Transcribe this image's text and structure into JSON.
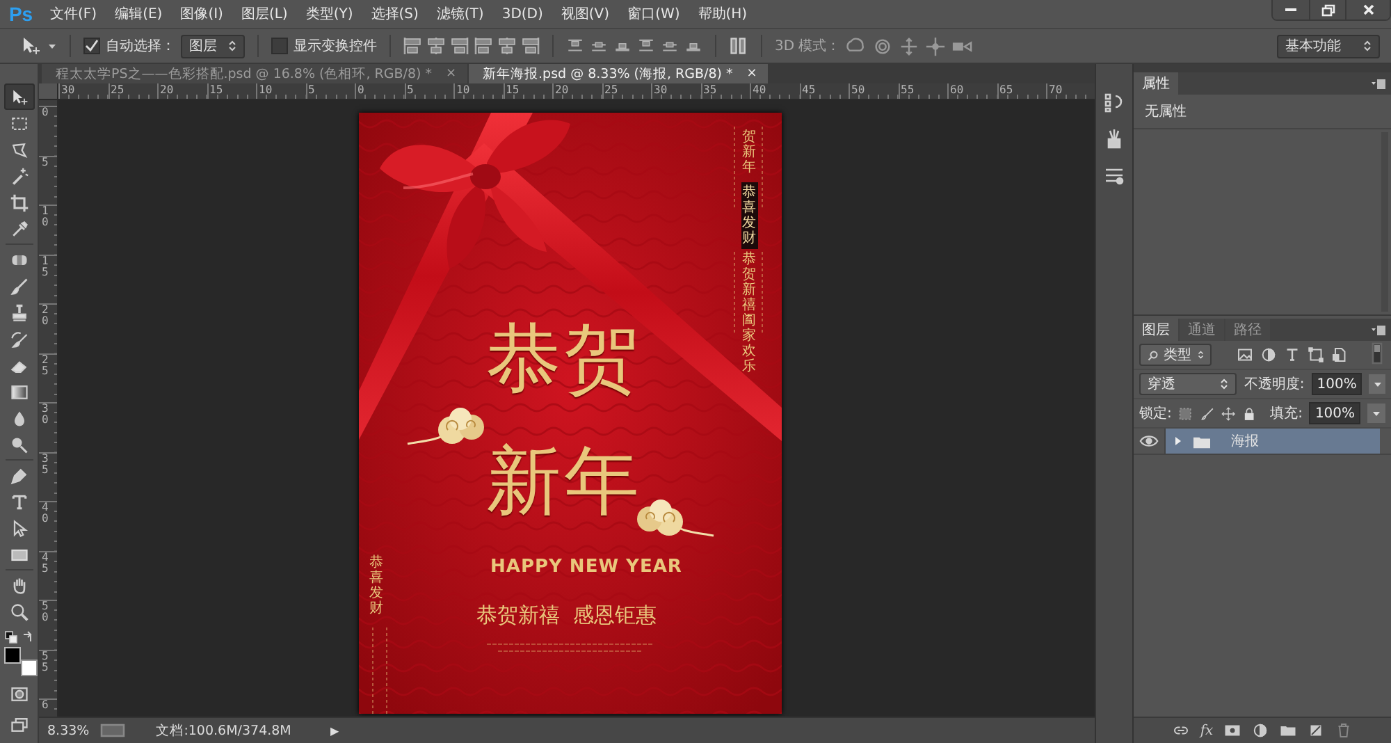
{
  "app_logo": "Ps",
  "menu": [
    "文件(F)",
    "编辑(E)",
    "图像(I)",
    "图层(L)",
    "类型(Y)",
    "选择(S)",
    "滤镜(T)",
    "3D(D)",
    "视图(V)",
    "窗口(W)",
    "帮助(H)"
  ],
  "options_bar": {
    "auto_select": {
      "label": "自动选择：",
      "checked": true
    },
    "auto_select_target": "图层",
    "show_transform": {
      "label": "显示变换控件",
      "checked": false
    },
    "mode_3d_label": "3D 模式：",
    "workspace": "基本功能"
  },
  "document_tabs": [
    {
      "label": "程太太学PS之——色彩搭配.psd @ 16.8% (色相环, RGB/8) *",
      "close": "×",
      "selected": false
    },
    {
      "label": "新年海报.psd @ 8.33% (海报, RGB/8) *",
      "close": "×",
      "selected": true
    }
  ],
  "tools": [
    {
      "kind": "move",
      "selected": true
    },
    {
      "kind": "marquee",
      "selected": false
    },
    {
      "kind": "lasso",
      "selected": false
    },
    {
      "kind": "wand",
      "selected": false
    },
    {
      "kind": "crop",
      "selected": false
    },
    {
      "kind": "eyedropper",
      "selected": false
    },
    {
      "kind": "healing",
      "selected": false
    },
    {
      "kind": "brush",
      "selected": false
    },
    {
      "kind": "stamp",
      "selected": false
    },
    {
      "kind": "history",
      "selected": false
    },
    {
      "kind": "eraser",
      "selected": false
    },
    {
      "kind": "gradient",
      "selected": false
    },
    {
      "kind": "blur",
      "selected": false
    },
    {
      "kind": "dodge",
      "selected": false
    },
    {
      "kind": "pen",
      "selected": false
    },
    {
      "kind": "type",
      "selected": false
    },
    {
      "kind": "path",
      "selected": false
    },
    {
      "kind": "shape",
      "selected": false
    },
    {
      "kind": "hand",
      "selected": false
    },
    {
      "kind": "zoom",
      "selected": false
    }
  ],
  "rulers": {
    "horizontal": [
      "30",
      "25",
      "20",
      "15",
      "10",
      "5",
      "0",
      "5",
      "10",
      "15",
      "20",
      "25",
      "30",
      "35",
      "40",
      "45",
      "50",
      "55",
      "60",
      "65",
      "70"
    ],
    "vertical": [
      "0",
      "5",
      "10",
      "15",
      "20",
      "25",
      "30",
      "35",
      "40",
      "45",
      "50",
      "55",
      "6"
    ]
  },
  "poster": {
    "side_text_top": "贺新年",
    "badge_text": "恭喜发财",
    "side_text_middle": "恭贺新禧阖家欢乐",
    "title_line_1": "恭贺",
    "title_line_2": "新年",
    "subtitle": "HAPPY NEW YEAR",
    "slogan": "恭贺新禧  感恩钜惠",
    "side_text_left": "恭喜发财"
  },
  "status_bar": {
    "zoom": "8.33%",
    "doc_info": "文档:100.6M/374.8M",
    "arrow": "▶"
  },
  "properties_panel": {
    "tab": "属性",
    "content": "无属性"
  },
  "layers_panel": {
    "tabs": [
      {
        "label": "图层",
        "selected": true
      },
      {
        "label": "通道",
        "selected": false
      },
      {
        "label": "路径",
        "selected": false
      }
    ],
    "filter": "类型",
    "blend_mode": "穿透",
    "opacity_label": "不透明度:",
    "opacity": "100%",
    "lock_label": "锁定:",
    "fill_label": "填充:",
    "fill": "100%",
    "layers": [
      {
        "name": "海报",
        "kind": "group",
        "visible": true,
        "expanded": false,
        "selected": true
      }
    ],
    "footer_fx": "fx"
  }
}
